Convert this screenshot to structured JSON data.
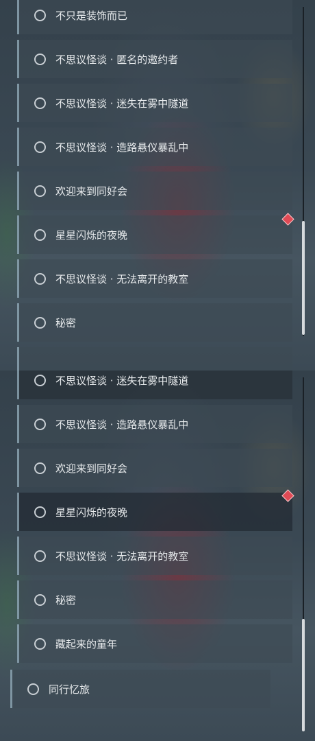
{
  "top_panel": {
    "quests": [
      {
        "label": "不只是装饰而已"
      },
      {
        "label": "不思议怪谈 · 匿名的邀约者"
      },
      {
        "label": "不思议怪谈 · 迷失在雾中隧道"
      },
      {
        "label": "不思议怪谈 · 造路悬仪暴乱中"
      },
      {
        "label": "欢迎来到同好会"
      },
      {
        "label": "星星闪烁的夜晚"
      },
      {
        "label": "不思议怪谈 · 无法离开的教室"
      },
      {
        "label": "秘密"
      }
    ]
  },
  "bottom_panel": {
    "quests": [
      {
        "label": "不思议怪谈 · 迷失在雾中隧道"
      },
      {
        "label": "不思议怪谈 · 造路悬仪暴乱中"
      },
      {
        "label": "欢迎来到同好会"
      },
      {
        "label": "星星闪烁的夜晚"
      },
      {
        "label": "不思议怪谈 · 无法离开的教室"
      },
      {
        "label": "秘密"
      },
      {
        "label": "藏起来的童年"
      },
      {
        "label": "同行忆旅"
      }
    ]
  },
  "colors": {
    "accent_marker": "#e04a55",
    "scroll_thumb": "#d6dadd"
  }
}
